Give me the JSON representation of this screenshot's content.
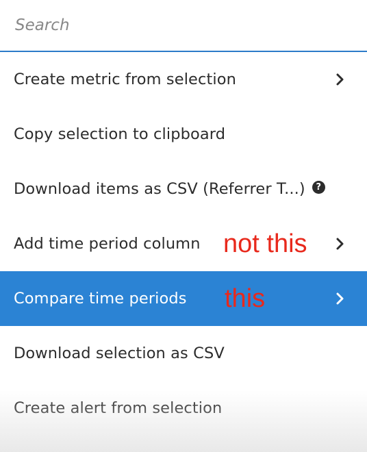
{
  "search": {
    "placeholder": "Search",
    "value": ""
  },
  "menu": {
    "items": [
      {
        "label": "Create metric from selection",
        "has_submenu": true
      },
      {
        "label": "Copy selection to clipboard",
        "has_submenu": false
      },
      {
        "label": "Download items as CSV (Referrer T...)",
        "has_submenu": false,
        "icon": "help-icon"
      },
      {
        "label": "Add time period column",
        "has_submenu": true
      },
      {
        "label": "Compare time periods",
        "has_submenu": true,
        "selected": true
      },
      {
        "label": "Download selection as CSV",
        "has_submenu": false
      },
      {
        "label": "Create alert from selection",
        "has_submenu": false
      }
    ]
  },
  "annotations": {
    "not_this": "not this",
    "this": "this"
  },
  "colors": {
    "selected_background": "#2b83d4",
    "search_underline": "#2c7bc9",
    "annotation_text": "#e8291c"
  }
}
